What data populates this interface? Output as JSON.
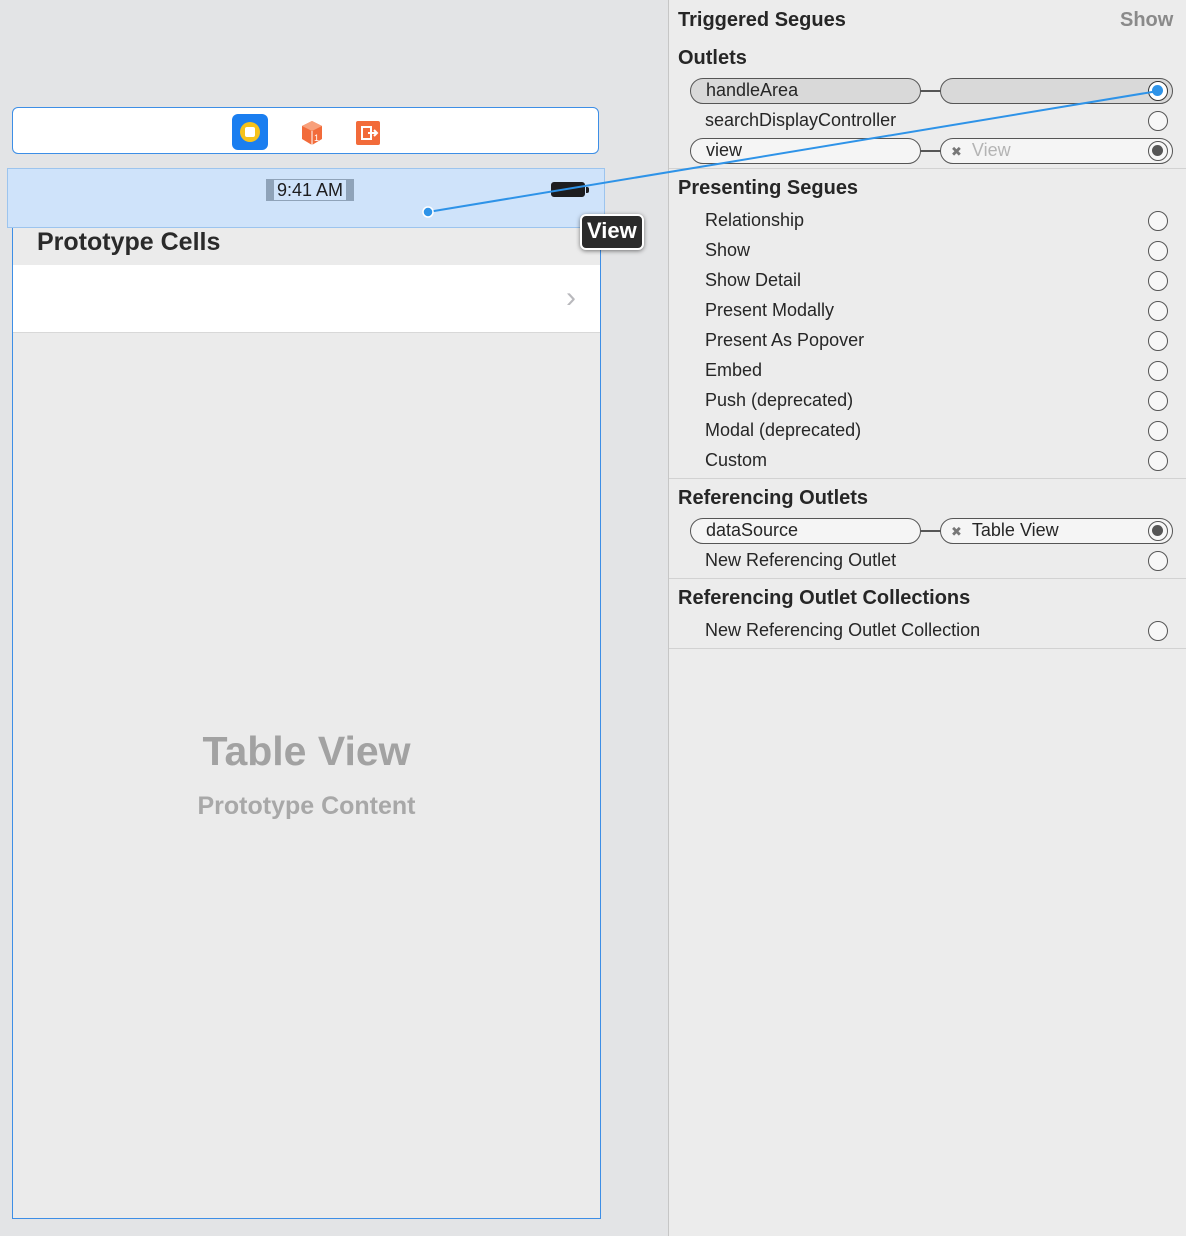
{
  "canvas": {
    "status_time": "9:41 AM",
    "nav_title": "Prototype Cells",
    "cell_chevron": "›",
    "table_title": "Table View",
    "table_subtitle": "Prototype Content",
    "drag_tooltip": "View",
    "dock_icons": [
      "view-controller-icon",
      "first-responder-icon",
      "exit-icon"
    ],
    "colors": {
      "selection": "#3d8ee6",
      "connection_line": "#2e93e8",
      "dock_vc": "#1a7ef0",
      "dock_vc_ring": "#f6c21a",
      "dock_orange": "#f26b3a"
    }
  },
  "inspector": {
    "triggered_segues": {
      "title": "Triggered Segues",
      "action": "Show"
    },
    "outlets": {
      "title": "Outlets",
      "rows": [
        {
          "name": "handleArea",
          "target": "",
          "state": "dragging"
        },
        {
          "name": "searchDisplayController",
          "target": "",
          "state": "empty"
        },
        {
          "name": "view",
          "target": "View",
          "state": "connected"
        }
      ]
    },
    "presenting_segues": {
      "title": "Presenting Segues",
      "rows": [
        "Relationship",
        "Show",
        "Show Detail",
        "Present Modally",
        "Present As Popover",
        "Embed",
        "Push (deprecated)",
        "Modal (deprecated)",
        "Custom"
      ]
    },
    "referencing_outlets": {
      "title": "Referencing Outlets",
      "connection": {
        "name": "dataSource",
        "target": "Table View"
      },
      "new_label": "New Referencing Outlet"
    },
    "referencing_outlet_collections": {
      "title": "Referencing Outlet Collections",
      "new_label": "New Referencing Outlet Collection"
    },
    "remove_glyph": "✖"
  }
}
